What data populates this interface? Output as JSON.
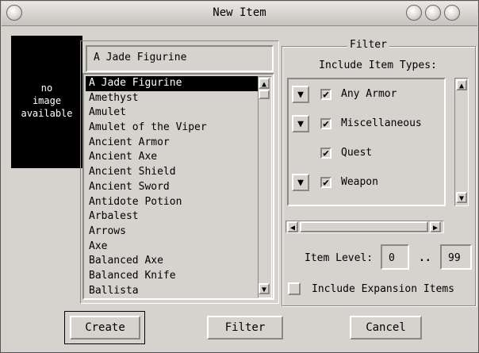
{
  "window": {
    "title": "New Item"
  },
  "image_placeholder": {
    "line1": "no",
    "line2": "image",
    "line3": "available"
  },
  "name_field": {
    "value": "A Jade Figurine"
  },
  "item_list": {
    "items": [
      "A Jade Figurine",
      "Amethyst",
      "Amulet",
      "Amulet of the Viper",
      "Ancient Armor",
      "Ancient Axe",
      "Ancient Shield",
      "Ancient Sword",
      "Antidote Potion",
      "Arbalest",
      "Arrows",
      "Axe",
      "Balanced Axe",
      "Balanced Knife",
      "Ballista"
    ],
    "selected_index": 0
  },
  "filter": {
    "legend": "Filter",
    "include_label": "Include Item Types:",
    "types": [
      {
        "label": "Any Armor",
        "checked": true,
        "has_dropdown": true
      },
      {
        "label": "Miscellaneous",
        "checked": true,
        "has_dropdown": true
      },
      {
        "label": "Quest",
        "checked": true,
        "has_dropdown": false
      },
      {
        "label": "Weapon",
        "checked": true,
        "has_dropdown": true
      }
    ],
    "item_level_label": "Item Level:",
    "level_min": "0",
    "level_sep": "..",
    "level_max": "99",
    "expansion_label": "Include Expansion Items",
    "expansion_checked": false
  },
  "buttons": {
    "create": "Create",
    "filter": "Filter",
    "cancel": "Cancel"
  },
  "icons": {
    "check": "✔",
    "dropdown": "▼"
  }
}
